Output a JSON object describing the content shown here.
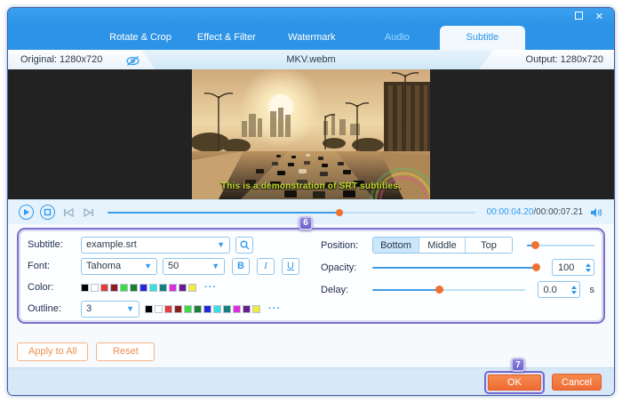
{
  "colors": {
    "accent_blue": "#2e9af0",
    "accent_orange": "#f07030",
    "badge_purple": "#6f64cf",
    "panel_outline_purple": "#7b72cc",
    "subtitle_text_color": "#c6d92e",
    "header_blue": "#2c93e6"
  },
  "titlebar": {
    "maximize_icon": "",
    "close_icon": "✕"
  },
  "tabs": {
    "items": [
      {
        "label": "Rotate & Crop"
      },
      {
        "label": "Effect & Filter"
      },
      {
        "label": "Watermark"
      },
      {
        "label": "Audio"
      },
      {
        "label": "Subtitle"
      }
    ],
    "active": "Subtitle"
  },
  "info_bar": {
    "original_label": "Original: 1280x720",
    "filename": "MKV.webm",
    "output_label": "Output: 1280x720"
  },
  "video": {
    "subtitle_text": "This is a demonstration of SRT subtitles."
  },
  "player": {
    "current_time": "00:00:04.20",
    "time_separator": "/",
    "total_time": "00:00:07.21",
    "progress_percent": 63,
    "step_badge": "6"
  },
  "subtitle_settings": {
    "subtitle_label": "Subtitle:",
    "subtitle_file": "example.srt",
    "font_label": "Font:",
    "font_family": "Tahoma",
    "font_size": "50",
    "bold_label": "B",
    "italic_label": "I",
    "underline_label": "U",
    "color_label": "Color:",
    "color_swatches": [
      "#000000",
      "#ffffff",
      "#e23c3c",
      "#8b1d1d",
      "#41d943",
      "#1b7e30",
      "#2626d9",
      "#35e0e0",
      "#1b7e7e",
      "#dd2ddd",
      "#6a1d8a",
      "#f0ec3d"
    ],
    "more_label": "···",
    "outline_label": "Outline:",
    "outline_value": "3",
    "outline_swatches": [
      "#000000",
      "#ffffff",
      "#e23c3c",
      "#8b1d1d",
      "#41d943",
      "#1b7e30",
      "#2626d9",
      "#35e0e0",
      "#1b7e7e",
      "#dd2ddd",
      "#6a1d8a",
      "#f0ec3d"
    ],
    "position_label": "Position:",
    "position_options": [
      "Bottom",
      "Middle",
      "Top"
    ],
    "position_selected": "Bottom",
    "position_percent": 12,
    "opacity_label": "Opacity:",
    "opacity_value": "100",
    "opacity_percent": 100,
    "delay_label": "Delay:",
    "delay_value": "0.0",
    "delay_unit": "s",
    "delay_percent": 44
  },
  "actions": {
    "apply_all": "Apply to All",
    "reset": "Reset",
    "step_badge": "7",
    "ok": "OK",
    "cancel": "Cancel"
  }
}
